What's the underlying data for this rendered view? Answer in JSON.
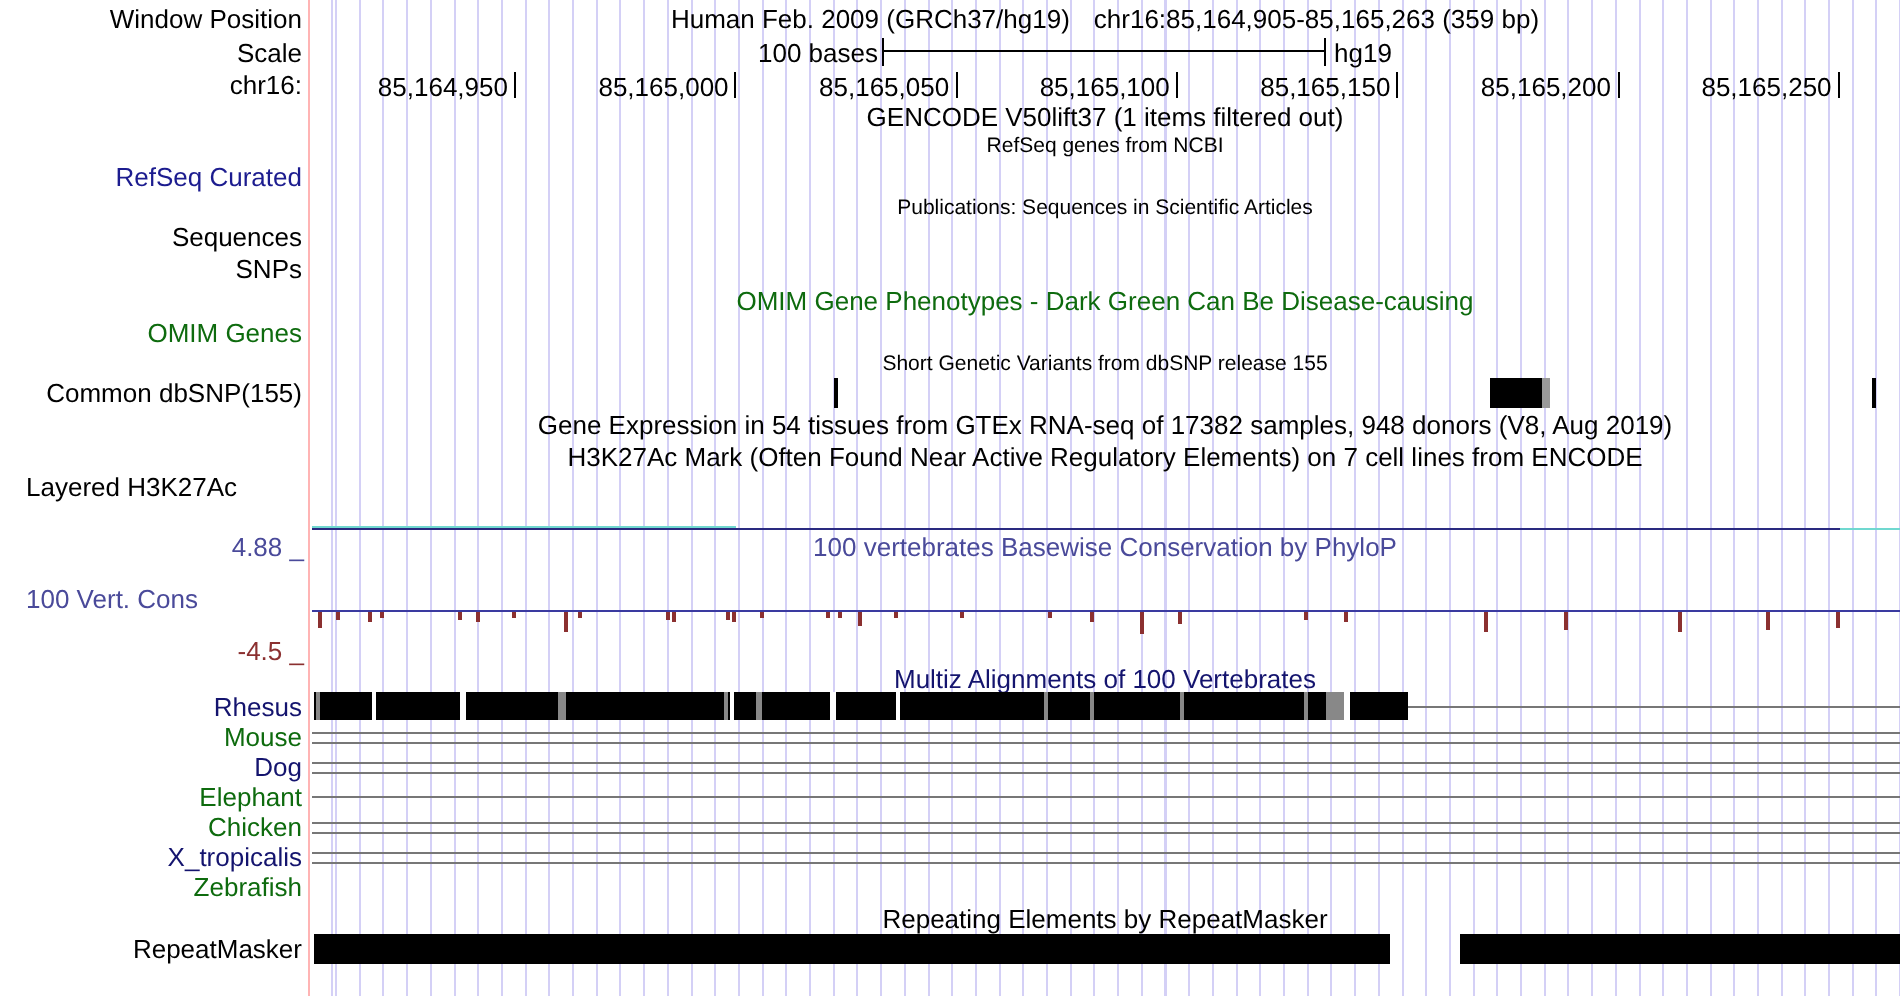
{
  "header": {
    "position_label": "Window Position",
    "assembly": "Human Feb. 2009 (GRCh37/hg19)",
    "position": "chr16:85,164,905-85,165,263 (359 bp)",
    "scale_label": "Scale",
    "scale_length": "100 bases",
    "scale_assembly": "hg19",
    "chrom_label": "chr16:",
    "ticks": [
      "85,164,950",
      "85,165,000",
      "85,165,050",
      "85,165,100",
      "85,165,150",
      "85,165,200",
      "85,165,250"
    ]
  },
  "tracks": [
    {
      "kind": "gencode",
      "title": "GENCODE V50lift37 (1 items filtered out)"
    },
    {
      "kind": "refseq",
      "title": "RefSeq genes from NCBI",
      "rows": [
        {
          "label": "RefSeq Curated",
          "color": "#1c1c8f"
        }
      ]
    },
    {
      "kind": "pubs",
      "title": "Publications: Sequences in Scientific Articles",
      "rows": [
        {
          "label": "Sequences",
          "color": "#000000"
        },
        {
          "label": "SNPs",
          "color": "#000000"
        }
      ]
    },
    {
      "kind": "omim",
      "title": "OMIM Gene Phenotypes - Dark Green Can Be Disease-causing",
      "color": "#0e6b0e",
      "rows": [
        {
          "label": "OMIM Genes",
          "color": "#0e6b0e"
        }
      ]
    },
    {
      "kind": "dbsnp",
      "title": "Short Genetic Variants from dbSNP release 155",
      "rows": [
        {
          "label": "Common dbSNP(155)",
          "color": "#000000"
        }
      ]
    },
    {
      "kind": "gtex",
      "title": "Gene Expression in 54 tissues from GTEx RNA-seq of 17382 samples, 948 donors (V8, Aug 2019)"
    },
    {
      "kind": "h3k27ac",
      "title": "H3K27Ac Mark (Often Found Near Active Regulatory Elements) on 7 cell lines from ENCODE",
      "rows": [
        {
          "label": "Layered H3K27Ac",
          "color": "#000000"
        }
      ]
    },
    {
      "kind": "phylop",
      "title": "100 vertebrates Basewise Conservation by PhyloP",
      "color": "#4a4a9a",
      "axis_max": "4.88 _",
      "axis_min": "-4.5 _",
      "rows": [
        {
          "label": "100 Vert. Cons",
          "color": "#4a4a9a"
        }
      ]
    },
    {
      "kind": "multiz",
      "title": "Multiz Alignments of 100 Vertebrates",
      "color": "#14146e",
      "rows": [
        {
          "label": "Rhesus",
          "color": "#14146e",
          "kind": "blocks"
        },
        {
          "label": "Mouse",
          "color": "#0e6b0e",
          "kind": "double-line"
        },
        {
          "label": "Dog",
          "color": "#14146e",
          "kind": "double-line"
        },
        {
          "label": "Elephant",
          "color": "#0e6b0e",
          "kind": "line"
        },
        {
          "label": "Chicken",
          "color": "#0e6b0e",
          "kind": "double-line"
        },
        {
          "label": "X_tropicalis",
          "color": "#14146e",
          "kind": "double-line"
        },
        {
          "label": "Zebrafish",
          "color": "#0e6b0e",
          "kind": "none"
        }
      ]
    },
    {
      "kind": "rmsk",
      "title": "Repeating Elements by RepeatMasker",
      "rows": [
        {
          "label": "RepeatMasker",
          "color": "#000000"
        }
      ]
    }
  ]
}
